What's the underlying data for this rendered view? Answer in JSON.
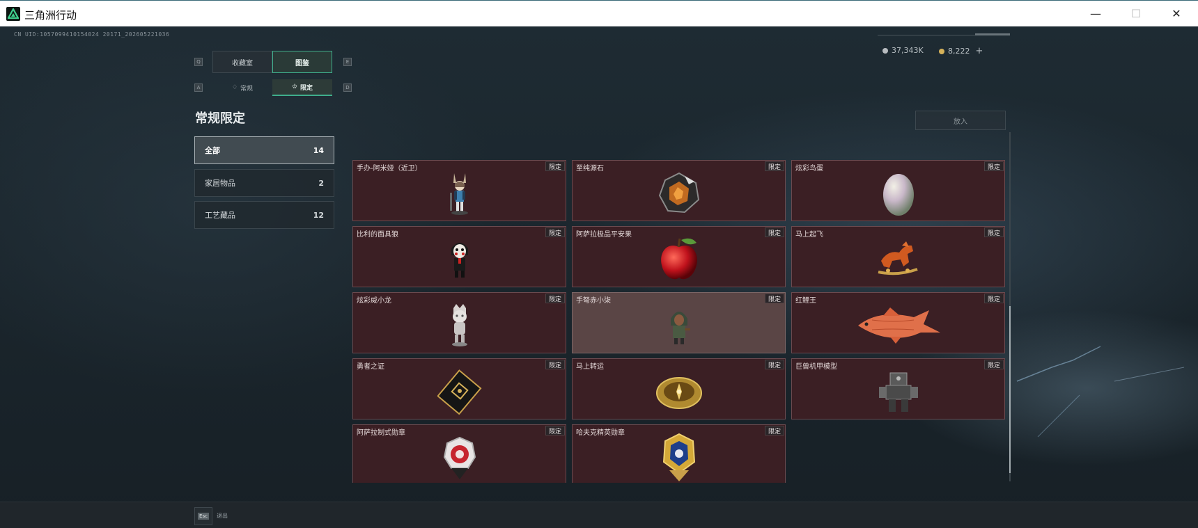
{
  "window": {
    "title": "三角洲行动",
    "min_glyph": "—",
    "max_glyph": "☐",
    "close_glyph": "✕"
  },
  "uid": "CN UID:1057099410154024 20171_202605221036",
  "key_hints": {
    "main_left": "Q",
    "main_right": "E",
    "sub_left": "A",
    "sub_right": "D"
  },
  "main_tabs": [
    {
      "label": "收藏室",
      "active": false
    },
    {
      "label": "图鉴",
      "active": true
    }
  ],
  "sub_tabs": [
    {
      "label": "常规",
      "icon": "flame-icon",
      "glyph": "♢",
      "active": false
    },
    {
      "label": "限定",
      "icon": "crown-icon",
      "glyph": "♔",
      "active": true
    }
  ],
  "section_title": "常规限定",
  "categories": [
    {
      "label": "全部",
      "count": "14",
      "active": true
    },
    {
      "label": "家居物品",
      "count": "2",
      "active": false
    },
    {
      "label": "工艺藏品",
      "count": "12",
      "active": false
    }
  ],
  "currency": [
    {
      "value": "37,343K",
      "color": "#b8bcc0",
      "icon": "silver-coin-icon"
    },
    {
      "value": "8,222",
      "color": "#d6b25a",
      "icon": "gold-coin-icon",
      "plus": "+"
    }
  ],
  "place_button": "放入",
  "badge_label": "限定",
  "items": [
    {
      "name": "手办-阿米娅（近卫）",
      "art": "figure-amiya"
    },
    {
      "name": "至纯源石",
      "art": "originium"
    },
    {
      "name": "炫彩鸟蛋",
      "art": "egg"
    },
    {
      "name": "比利的面具狼",
      "art": "puppet"
    },
    {
      "name": "阿萨拉极品平安果",
      "art": "apple"
    },
    {
      "name": "马上起飞",
      "art": "horse"
    },
    {
      "name": "炫彩威小龙",
      "art": "silver-figure"
    },
    {
      "name": "手弩赤小柒",
      "art": "hooded-figure"
    },
    {
      "name": "红鲤王",
      "art": "carp"
    },
    {
      "name": "勇者之证",
      "art": "card"
    },
    {
      "name": "马上转运",
      "art": "compass"
    },
    {
      "name": "巨兽机甲模型",
      "art": "mech"
    },
    {
      "name": "阿萨拉制式勋章",
      "art": "medal-red"
    },
    {
      "name": "哈夫克精英勋章",
      "art": "medal-blue"
    }
  ],
  "back_hint": {
    "key": "Esc",
    "label": "退出"
  }
}
